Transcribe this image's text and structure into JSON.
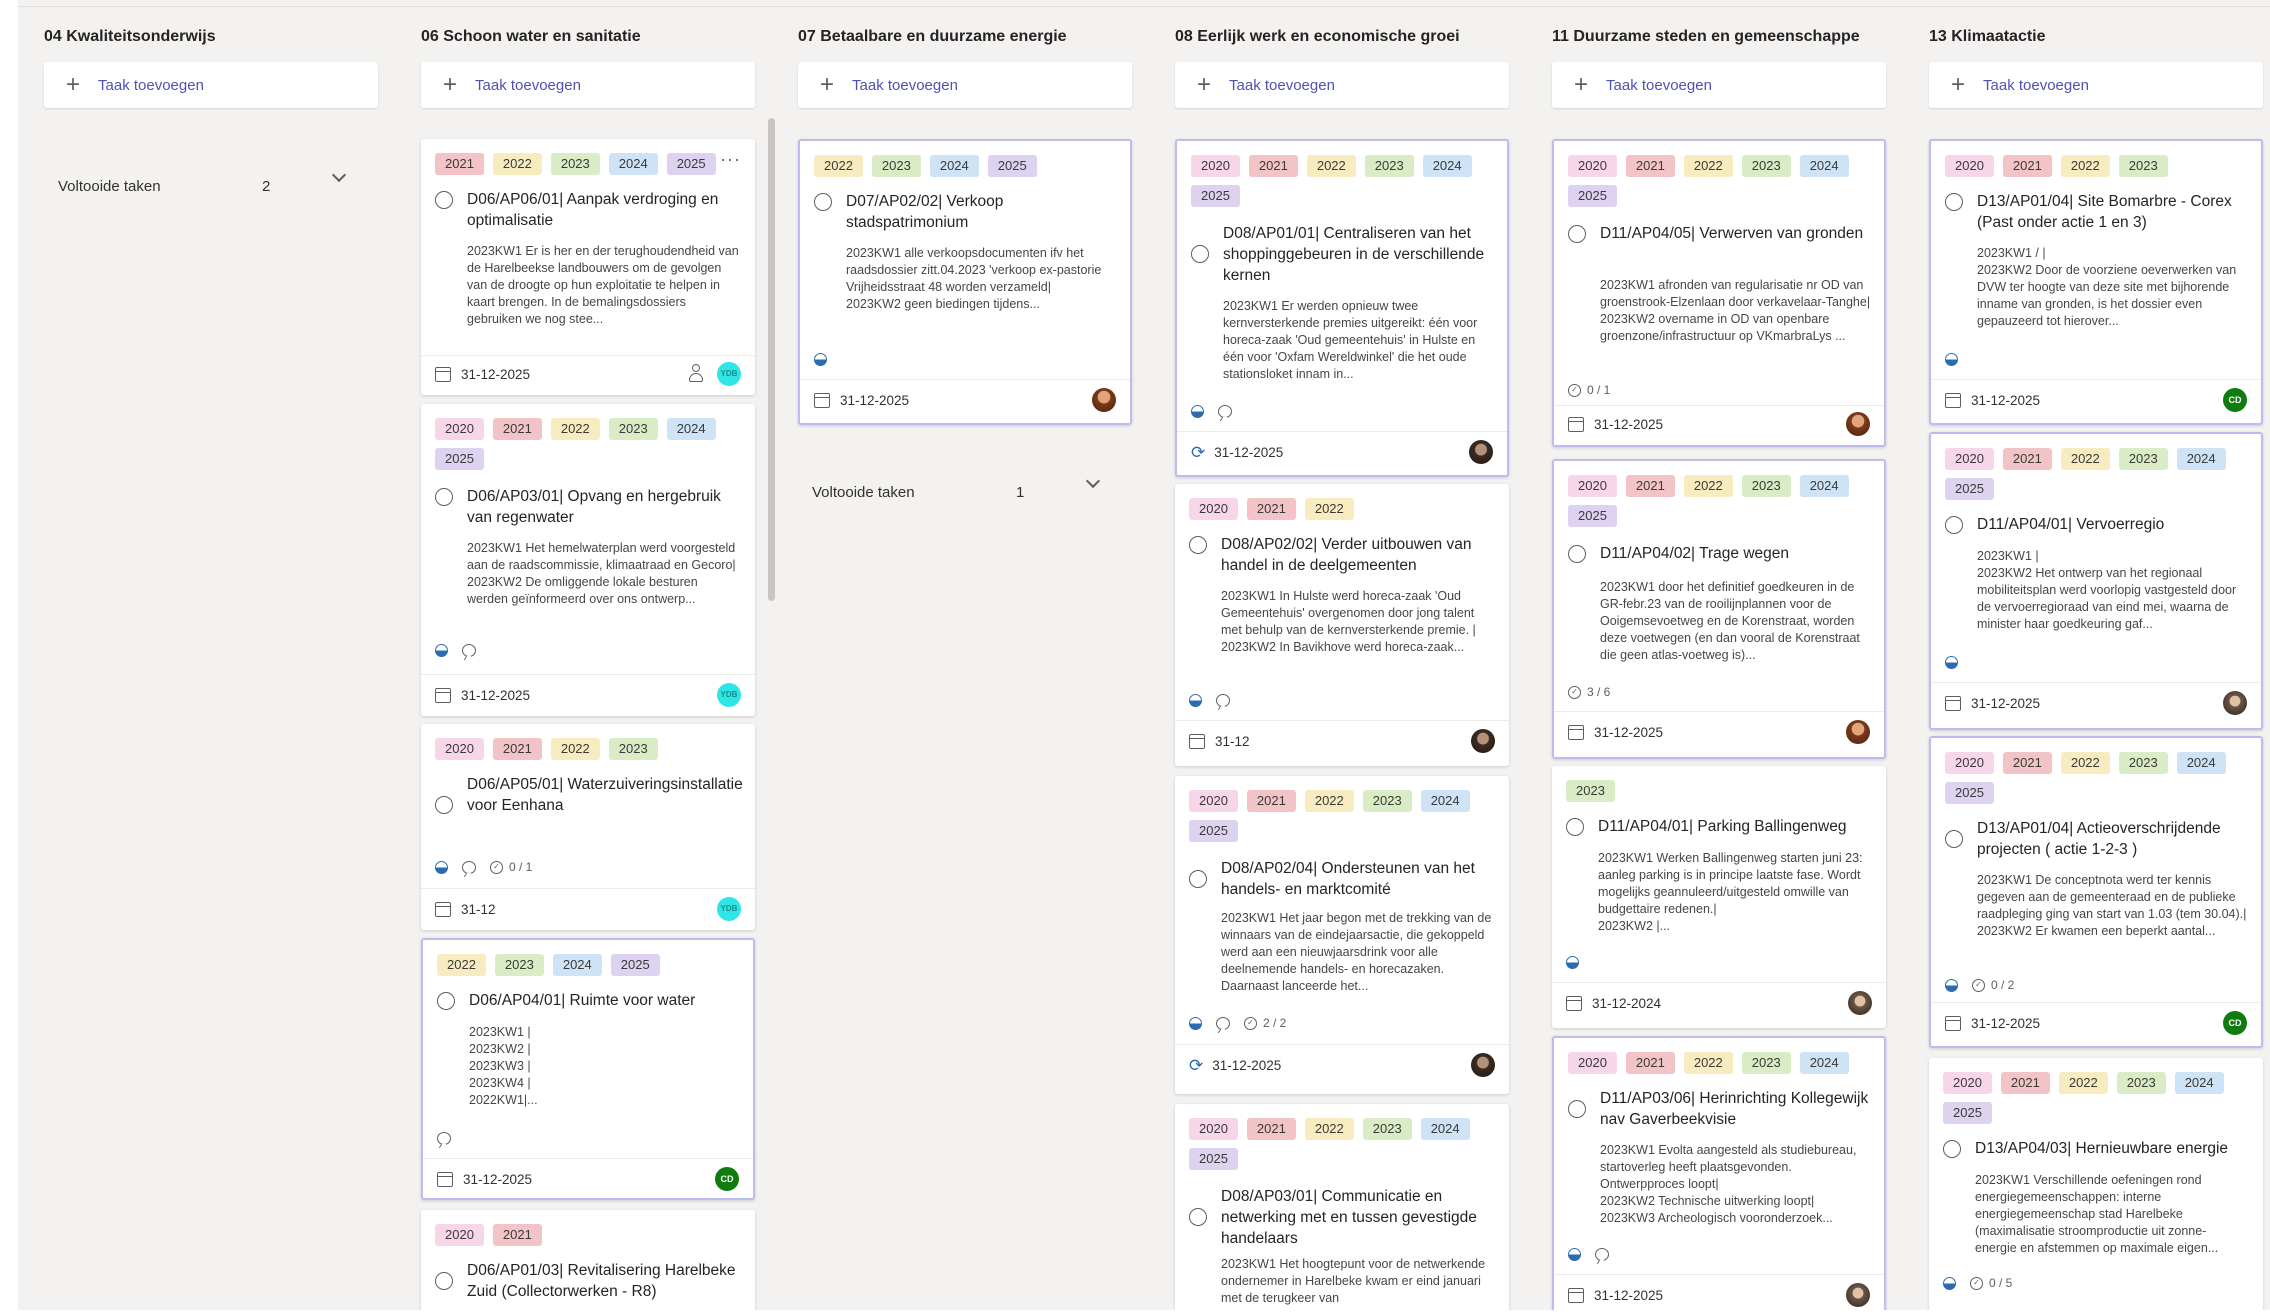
{
  "buckets": [
    {
      "title": "04 Kwaliteitsonderwijs",
      "add_label": "Taak toevoegen",
      "completed": {
        "label": "Voltooide taken",
        "count": "2"
      },
      "cards": []
    },
    {
      "title": "06 Schoon water en sanitatie",
      "add_label": "Taak toevoegen",
      "cards": [
        {
          "labels": [
            "2021",
            "2022",
            "2023",
            "2024",
            "2025"
          ],
          "title": "D06/AP06/01| Aanpak verdroging en optimalisatie",
          "desc": "2023KW1 Er is her en der terughoudendheid van de Harelbeekse landbouwers om de gevolgen van de droogte op hun exploitatie te helpen in kaart brengen. In de bemalingsdossiers gebruiken we nog stee...",
          "date": "31-12-2025",
          "avatar": "YDB"
        },
        {
          "labels": [
            "2020",
            "2021",
            "2022",
            "2023",
            "2024",
            "2025"
          ],
          "title": "D06/AP03/01| Opvang en hergebruik van regenwater",
          "desc": "2023KW1 Het hemelwaterplan werd voorgesteld aan de raadscommissie, klimaatraad en Gecoro|\n2023KW2 De omliggende lokale besturen werden geïnformeerd over ons ontwerp...",
          "date": "31-12-2025",
          "avatar": "YDB"
        },
        {
          "labels": [
            "2020",
            "2021",
            "2022",
            "2023"
          ],
          "title": "D06/AP05/01| Waterzuiveringsinstallatie voor Eenhana",
          "checklist": "0 / 1",
          "date": "31-12",
          "avatar": "YDB"
        },
        {
          "labels": [
            "2022",
            "2023",
            "2024",
            "2025"
          ],
          "title": "D06/AP04/01| Ruimte voor water",
          "desc": "2023KW1 |\n2023KW2 |\n2023KW3 |\n2023KW4 |\n2022KW1|...",
          "date": "31-12-2025",
          "avatar": "CD"
        },
        {
          "labels": [
            "2020",
            "2021"
          ],
          "title": "D06/AP01/03| Revitalisering Harelbeke Zuid (Collectorwerken - R8)"
        }
      ]
    },
    {
      "title": "07 Betaalbare en duurzame energie",
      "add_label": "Taak toevoegen",
      "completed": {
        "label": "Voltooide taken",
        "count": "1"
      },
      "cards": [
        {
          "labels": [
            "2022",
            "2023",
            "2024",
            "2025"
          ],
          "title": "D07/AP02/02| Verkoop stadspatrimonium",
          "desc": "2023KW1 alle verkoopsdocumenten ifv het raadsdossier zitt.04.2023 'verkoop ex-pastorie Vrijheidsstraat 48 worden verzameld|\n2023KW2 geen biedingen tijdens...",
          "date": "31-12-2025"
        }
      ]
    },
    {
      "title": "08 Eerlijk werk en economische groei",
      "add_label": "Taak toevoegen",
      "cards": [
        {
          "labels": [
            "2020",
            "2021",
            "2022",
            "2023",
            "2024",
            "2025"
          ],
          "title": "D08/AP01/01| Centraliseren van het shoppinggebeuren in de verschillende kernen",
          "desc": "2023KW1 Er werden opnieuw twee kernversterkende premies uitgereikt: één voor horeca-zaak 'Oud gemeentehuis' in Hulste en één voor 'Oxfam Wereldwinkel' die het oude stationsloket innam in...",
          "date": "31-12-2025"
        },
        {
          "labels": [
            "2020",
            "2021",
            "2022"
          ],
          "title": "D08/AP02/02| Verder uitbouwen van handel in de deelgemeenten",
          "desc": "2023KW1 In Hulste werd horeca-zaak 'Oud Gemeentehuis' overgenomen door jong talent met behulp van de kernversterkende premie. |\n2023KW2 In Bavikhove werd horeca-zaak...",
          "date": "31-12"
        },
        {
          "labels": [
            "2020",
            "2021",
            "2022",
            "2023",
            "2024",
            "2025"
          ],
          "title": "D08/AP02/04| Ondersteunen van het handels- en marktcomité",
          "desc": "2023KW1 Het jaar begon met de trekking van de winnaars van de eindejaarsactie, die gekoppeld werd aan een nieuwjaarsdrink voor alle deelnemende handels- en horecazaken. Daarnaast lanceerde het...",
          "checklist": "2 / 2",
          "date": "31-12-2025"
        },
        {
          "labels": [
            "2020",
            "2021",
            "2022",
            "2023",
            "2024",
            "2025"
          ],
          "title": "D08/AP03/01| Communicatie en netwerking met en tussen gevestigde handelaars",
          "desc": "2023KW1 Het hoogtepunt voor de netwerkende ondernemer in Harelbeke kwam er eind januari met de terugkeer van"
        }
      ]
    },
    {
      "title": "11 Duurzame steden en gemeenschappe",
      "add_label": "Taak toevoegen",
      "cards": [
        {
          "labels": [
            "2020",
            "2021",
            "2022",
            "2023",
            "2024",
            "2025"
          ],
          "title": "D11/AP04/05| Verwerven van gronden",
          "desc": "2023KW1 afronden van regularisatie nr OD van groenstrook-Elzenlaan door verkavelaar-Tanghe|\n2023KW2 overname in OD van openbare groenzone/infrastructuur op VKmarbraLys ...",
          "checklist": "0 / 1",
          "date": "31-12-2025"
        },
        {
          "labels": [
            "2020",
            "2021",
            "2022",
            "2023",
            "2024",
            "2025"
          ],
          "title": "D11/AP04/02| Trage wegen",
          "desc": "2023KW1 door het definitief goedkeuren in de GR-febr.23 van de rooilijnplannen voor de Ooigemsevoetweg en de Korenstraat, worden deze voetwegen (en dan vooral de Korenstraat die geen atlas-voetweg is)...",
          "checklist": "3 / 6",
          "date": "31-12-2025"
        },
        {
          "labels": [
            "2023"
          ],
          "title": "D11/AP04/01| Parking Ballingenweg",
          "desc": "2023KW1 Werken Ballingenweg starten juni 23: aanleg parking is in principe laatste fase. Wordt mogelijks geannuleerd/uitgesteld omwille van budgettaire redenen.|\n2023KW2 |...",
          "date": "31-12-2024"
        },
        {
          "labels": [
            "2020",
            "2021",
            "2022",
            "2023",
            "2024"
          ],
          "title": "D11/AP03/06| Herinrichting Kollegewijk nav Gaverbeekvisie",
          "desc": "2023KW1 Evolta aangesteld als studiebureau, startoverleg heeft plaatsgevonden. Ontwerpproces loopt|\n2023KW2 Technische uitwerking loopt|\n2023KW3 Archeologisch vooronderzoek...",
          "date": "31-12-2025"
        }
      ]
    },
    {
      "title": "13 Klimaatactie",
      "add_label": "Taak toevoegen",
      "cards": [
        {
          "labels": [
            "2020",
            "2021",
            "2022",
            "2023"
          ],
          "title": "D13/AP01/04| Site Bomarbre - Corex (Past onder actie 1 en 3)",
          "desc": "2023KW1 / |\n2023KW2 Door de voorziene oeverwerken van DVW ter hoogte van deze site met bijhorende inname van gronden, is het dossier even gepauzeerd tot hierover...",
          "date": "31-12-2025",
          "avatar": "CD"
        },
        {
          "labels": [
            "2020",
            "2021",
            "2022",
            "2023",
            "2024",
            "2025"
          ],
          "title": "D11/AP04/01| Vervoerregio",
          "desc": "2023KW1 |\n2023KW2 Het ontwerp van het regionaal mobiliteitsplan werd voorlopig vastgesteld door de vervoerregioraad van eind mei, waarna de minister haar goedkeuring gaf...",
          "date": "31-12-2025"
        },
        {
          "labels": [
            "2020",
            "2021",
            "2022",
            "2023",
            "2024",
            "2025"
          ],
          "title": "D13/AP01/04| Actieoverschrijdende projecten ( actie 1-2-3 )",
          "desc": "2023KW1 De conceptnota werd ter kennis gegeven aan de gemeenteraad en de publieke raadpleging ging van start van 1.03 (tem 30.04).|\n2023KW2 Er kwamen een beperkt aantal...",
          "checklist": "0 / 2",
          "date": "31-12-2025",
          "avatar": "CD"
        },
        {
          "labels": [
            "2020",
            "2021",
            "2022",
            "2023",
            "2024",
            "2025"
          ],
          "title": "D13/AP04/03| Hernieuwbare energie",
          "desc": "2023KW1 Verschillende oefeningen rond energiegemeenschappen: interne energiegemeenschap stad Harelbeke (maximalisatie stroomproductie uit zonne-energie en afstemmen op maximale eigen...",
          "checklist": "0 / 5"
        }
      ]
    }
  ]
}
